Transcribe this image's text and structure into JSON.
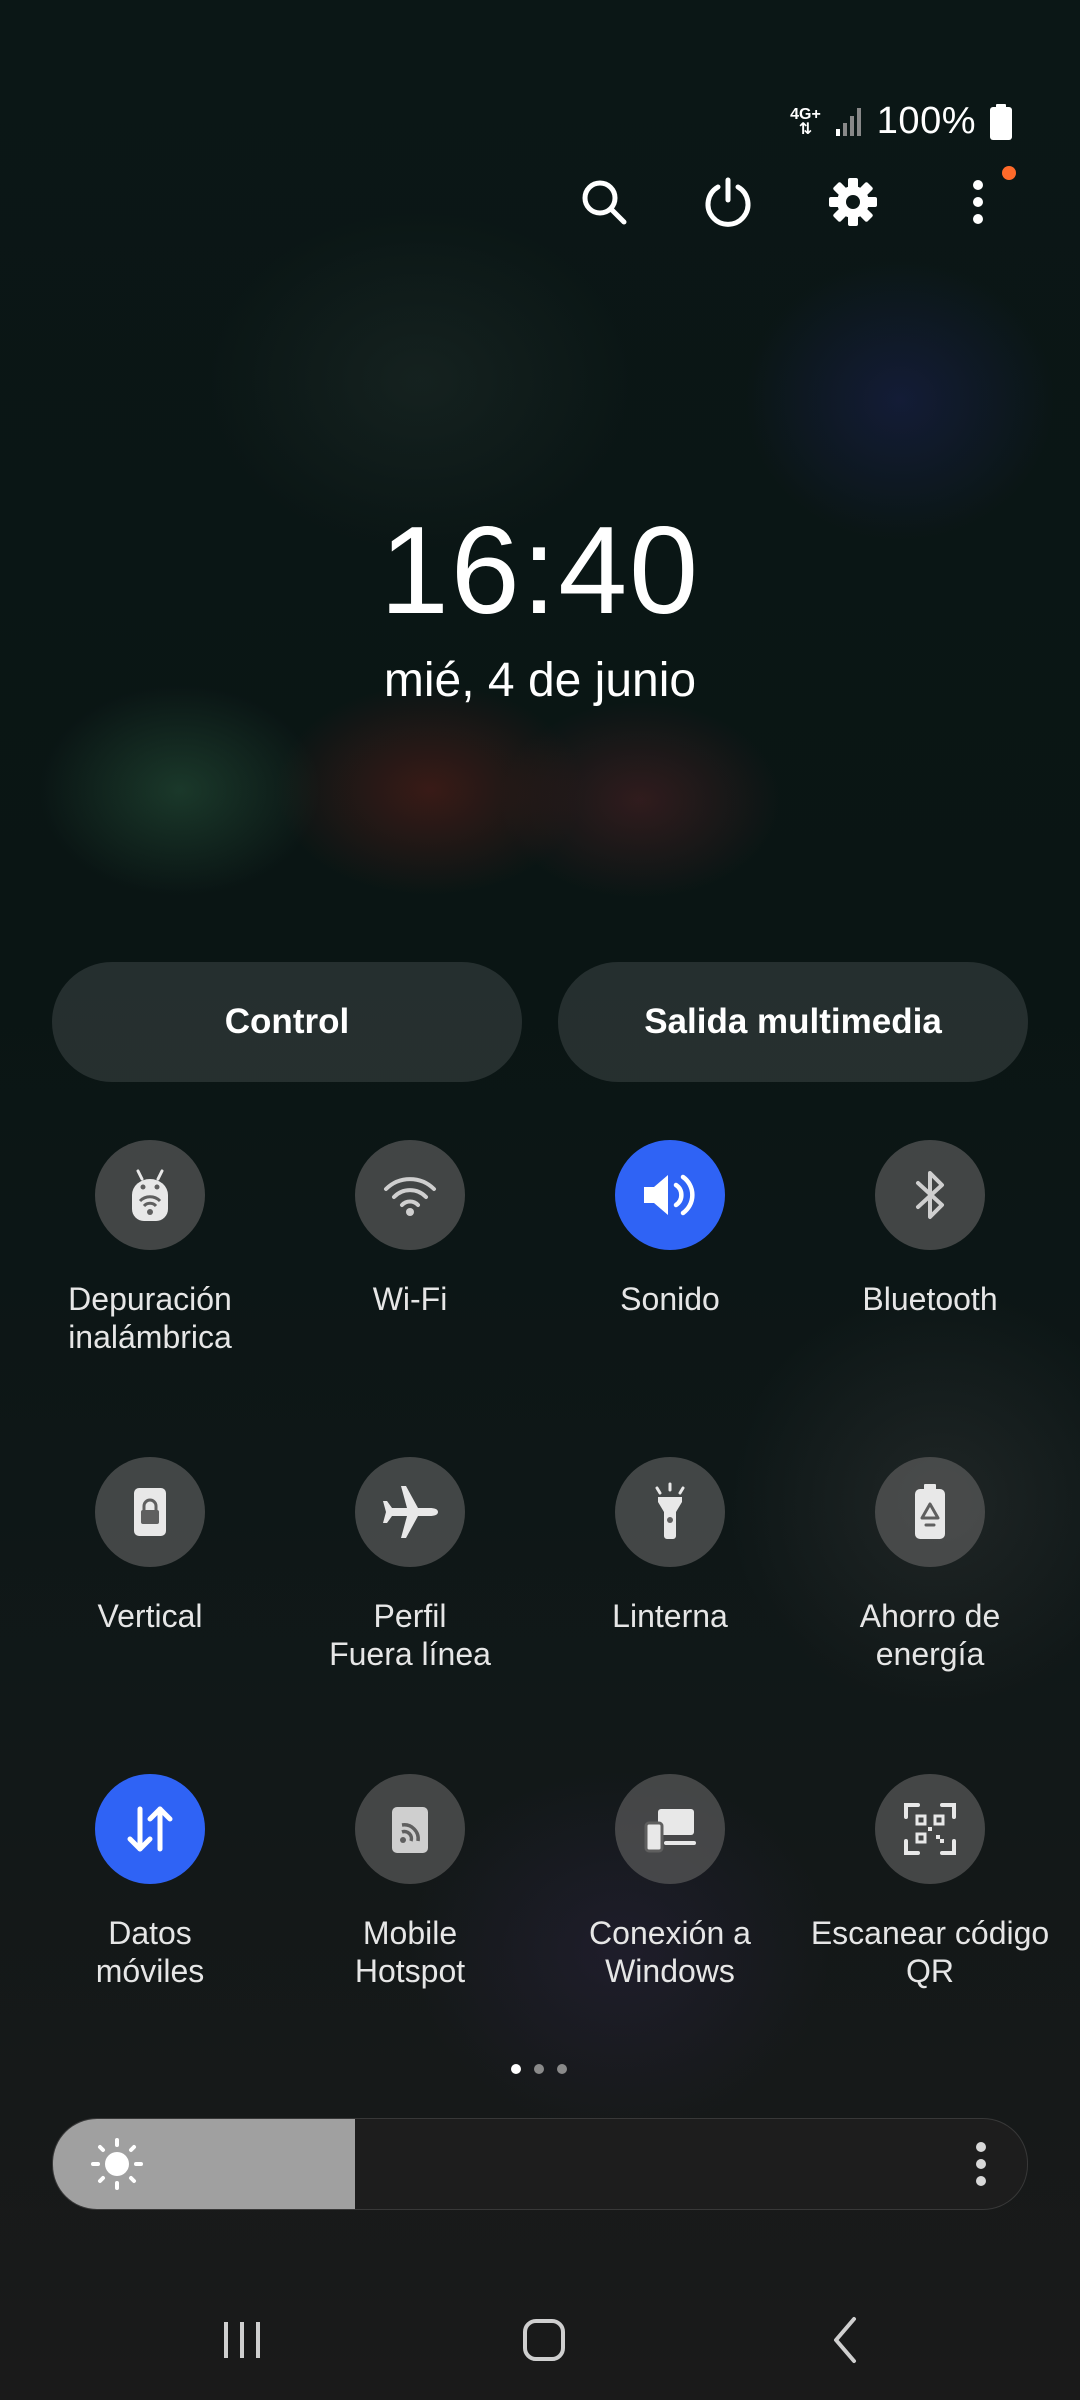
{
  "status_bar": {
    "network_type": "4G+",
    "battery_percent": "100%",
    "icons": [
      "data-arrows-icon",
      "signal-icon",
      "battery-icon"
    ]
  },
  "header_actions": [
    {
      "name": "search-icon"
    },
    {
      "name": "power-icon"
    },
    {
      "name": "settings-icon"
    },
    {
      "name": "more-options-icon"
    }
  ],
  "clock": {
    "time": "16:40",
    "date": "mié, 4 de junio"
  },
  "pills": {
    "control": "Control",
    "media_output": "Salida multimedia"
  },
  "tiles": [
    {
      "label": "Depuración\ninalámbrica",
      "icon": "wireless-debugging-icon",
      "active": false
    },
    {
      "label": "Wi-Fi",
      "icon": "wifi-icon",
      "active": false
    },
    {
      "label": "Sonido",
      "icon": "sound-icon",
      "active": true
    },
    {
      "label": "Bluetooth",
      "icon": "bluetooth-icon",
      "active": false
    },
    {
      "label": "Vertical",
      "icon": "portrait-lock-icon",
      "active": false
    },
    {
      "label": "Perfil\nFuera línea",
      "icon": "airplane-icon",
      "active": false
    },
    {
      "label": "Linterna",
      "icon": "flashlight-icon",
      "active": false
    },
    {
      "label": "Ahorro de\nenergía",
      "icon": "power-saving-icon",
      "active": false
    },
    {
      "label": "Datos\nmóviles",
      "icon": "mobile-data-icon",
      "active": true
    },
    {
      "label": "Mobile\nHotspot",
      "icon": "hotspot-icon",
      "active": false
    },
    {
      "label": "Conexión a\nWindows",
      "icon": "link-to-windows-icon",
      "active": false
    },
    {
      "label": "Escanear código\nQR",
      "icon": "qr-scan-icon",
      "active": false
    }
  ],
  "pagination": {
    "pages": 3,
    "current": 1
  },
  "brightness": {
    "level_fraction": 0.31
  },
  "navigation": [
    "recent-apps-icon",
    "home-icon",
    "back-icon"
  ],
  "colors": {
    "active_tile": "#2f63f5",
    "badge": "#ff6a2a"
  }
}
